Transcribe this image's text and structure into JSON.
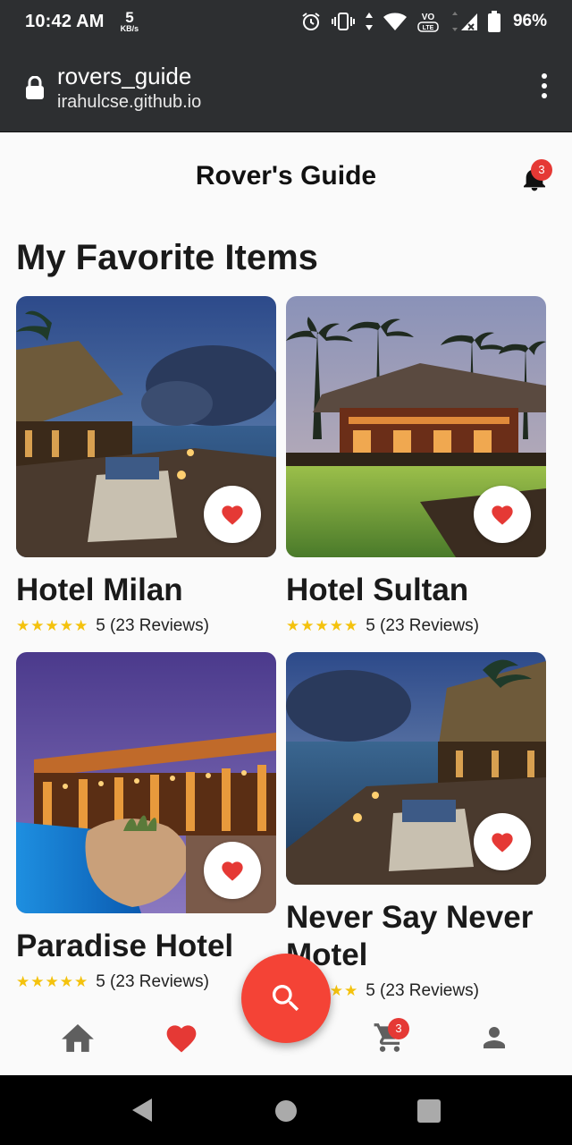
{
  "status_bar": {
    "time": "10:42 AM",
    "speed_value": "5",
    "speed_unit": "KB/s",
    "battery": "96%"
  },
  "browser": {
    "title": "rovers_guide",
    "host": "irahulcse.github.io"
  },
  "app": {
    "title": "Rover's Guide",
    "notification_count": "3"
  },
  "section_title": "My Favorite Items",
  "items": [
    {
      "name": "Hotel Milan",
      "stars": "★★★★★",
      "rating": "5 (23 Reviews)"
    },
    {
      "name": "Hotel Sultan",
      "stars": "★★★★★",
      "rating": "5 (23 Reviews)"
    },
    {
      "name": "Paradise Hotel",
      "stars": "★★★★★",
      "rating": "5 (23 Reviews)"
    },
    {
      "name": "Never Say Never Motel",
      "stars": "★★★★★",
      "rating": "5 (23 Reviews)"
    }
  ],
  "bottom_nav": {
    "cart_count": "3",
    "icons": [
      "home-icon",
      "heart-icon",
      "search-icon",
      "cart-icon",
      "person-icon"
    ]
  },
  "colors": {
    "accent": "#f44336",
    "badge": "#e53935",
    "star": "#f4c20d",
    "chrome": "#2d2f31"
  }
}
